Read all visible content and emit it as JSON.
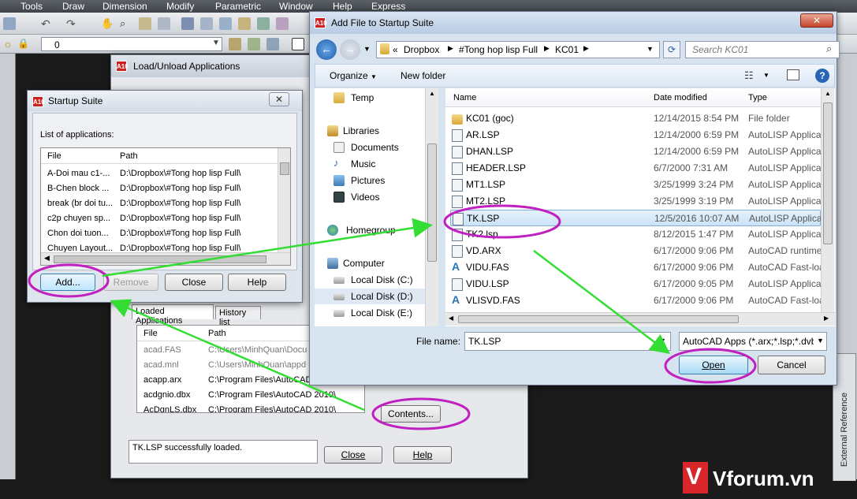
{
  "menubar": {
    "items": [
      "Tools",
      "Draw",
      "Dimension",
      "Modify",
      "Parametric",
      "Window",
      "Help",
      "Express"
    ]
  },
  "layer_combo": {
    "value": "0"
  },
  "load_unload": {
    "title": "Load/Unload Applications",
    "tabs": [
      "Loaded Applications",
      "History list"
    ],
    "columns": [
      "File",
      "Path"
    ],
    "rows": [
      {
        "file": "acad.FAS",
        "path": "C:\\Users\\MinhQuan\\Docu"
      },
      {
        "file": "acad.mnl",
        "path": "C:\\Users\\MinhQuan\\appd"
      },
      {
        "file": "acapp.arx",
        "path": "C:\\Program Files\\AutoCAD"
      },
      {
        "file": "acdgnio.dbx",
        "path": "C:\\Program Files\\AutoCAD 2010\\"
      },
      {
        "file": "AcDgnLS.dbx",
        "path": "C:\\Program Files\\AutoCAD 2010\\"
      }
    ],
    "contents_button": "Contents...",
    "status": "TK.LSP successfully loaded.",
    "close_button": "Close",
    "help_button": "Help"
  },
  "startup_suite": {
    "title": "Startup Suite",
    "list_label": "List of applications:",
    "columns": [
      "File",
      "Path"
    ],
    "rows": [
      {
        "file": "A-Doi mau c1-...",
        "path": "D:\\Dropbox\\#Tong hop lisp Full\\"
      },
      {
        "file": "B-Chen block ...",
        "path": "D:\\Dropbox\\#Tong hop lisp Full\\"
      },
      {
        "file": "break (br doi tu...",
        "path": "D:\\Dropbox\\#Tong hop lisp Full\\"
      },
      {
        "file": "c2p chuyen sp...",
        "path": "D:\\Dropbox\\#Tong hop lisp Full\\"
      },
      {
        "file": "Chon doi tuon...",
        "path": "D:\\Dropbox\\#Tong hop lisp Full\\"
      },
      {
        "file": "Chuyen Layout...",
        "path": "D:\\Dropbox\\#Tong hop lisp Full\\"
      }
    ],
    "add_button": "Add...",
    "remove_button": "Remove",
    "close_button": "Close",
    "help_button": "Help",
    "close_x": "✕"
  },
  "file_dialog": {
    "title": "Add File to Startup Suite",
    "breadcrumb": [
      "«",
      "Dropbox",
      "#Tong hop lisp Full",
      "KC01"
    ],
    "search_placeholder": "Search KC01",
    "organize": "Organize",
    "new_folder": "New folder",
    "nav_items": [
      {
        "label": "Temp",
        "kind": "folder"
      },
      {
        "label": "Libraries",
        "kind": "library"
      },
      {
        "label": "Documents",
        "kind": "doc"
      },
      {
        "label": "Music",
        "kind": "music"
      },
      {
        "label": "Pictures",
        "kind": "pic"
      },
      {
        "label": "Videos",
        "kind": "video"
      },
      {
        "label": "Homegroup",
        "kind": "home"
      },
      {
        "label": "Computer",
        "kind": "computer"
      },
      {
        "label": "Local Disk (C:)",
        "kind": "disk"
      },
      {
        "label": "Local Disk (D:)",
        "kind": "disk"
      },
      {
        "label": "Local Disk (E:)",
        "kind": "disk"
      }
    ],
    "columns": [
      "Name",
      "Date modified",
      "Type"
    ],
    "files": [
      {
        "name": "KC01 (goc)",
        "date": "12/14/2015 8:54 PM",
        "type": "File folder",
        "kind": "folder"
      },
      {
        "name": "AR.LSP",
        "date": "12/14/2000 6:59 PM",
        "type": "AutoLISP Applica",
        "kind": "lsp"
      },
      {
        "name": "DHAN.LSP",
        "date": "12/14/2000 6:59 PM",
        "type": "AutoLISP Applica",
        "kind": "lsp"
      },
      {
        "name": "HEADER.LSP",
        "date": "6/7/2000 7:31 AM",
        "type": "AutoLISP Applica",
        "kind": "lsp"
      },
      {
        "name": "MT1.LSP",
        "date": "3/25/1999 3:24 PM",
        "type": "AutoLISP Applica",
        "kind": "lsp"
      },
      {
        "name": "MT2.LSP",
        "date": "3/25/1999 3:19 PM",
        "type": "AutoLISP Applica",
        "kind": "lsp"
      },
      {
        "name": "TK.LSP",
        "date": "12/5/2016 10:07 AM",
        "type": "AutoLISP Applica",
        "kind": "lsp"
      },
      {
        "name": "TK2.lsp",
        "date": "8/12/2015 1:47 PM",
        "type": "AutoLISP Applica",
        "kind": "lsp"
      },
      {
        "name": "VD.ARX",
        "date": "6/17/2000 9:06 PM",
        "type": "AutoCAD runtime",
        "kind": "arx"
      },
      {
        "name": "VIDU.FAS",
        "date": "6/17/2000 9:06 PM",
        "type": "AutoCAD Fast-loa",
        "kind": "fas"
      },
      {
        "name": "VIDU.LSP",
        "date": "6/17/2000 9:05 PM",
        "type": "AutoLISP Applica",
        "kind": "lsp"
      },
      {
        "name": "VLISVD.FAS",
        "date": "6/17/2000 9:06 PM",
        "type": "AutoCAD Fast-loa",
        "kind": "fas"
      }
    ],
    "selected_index": 6,
    "filename_label": "File name:",
    "filename_value": "TK.LSP",
    "filetype_value": "AutoCAD Apps (*.arx;*.lsp;*.dvb",
    "open_button": "Open",
    "cancel_button": "Cancel",
    "close_x": "✕"
  },
  "side_panel": {
    "label": "External Reference"
  },
  "watermark": {
    "text": "Vforum.vn"
  },
  "colors": {
    "accent_annotation": "#c020c0",
    "arrow": "#33dd33",
    "selection": "#cbe3f7"
  }
}
